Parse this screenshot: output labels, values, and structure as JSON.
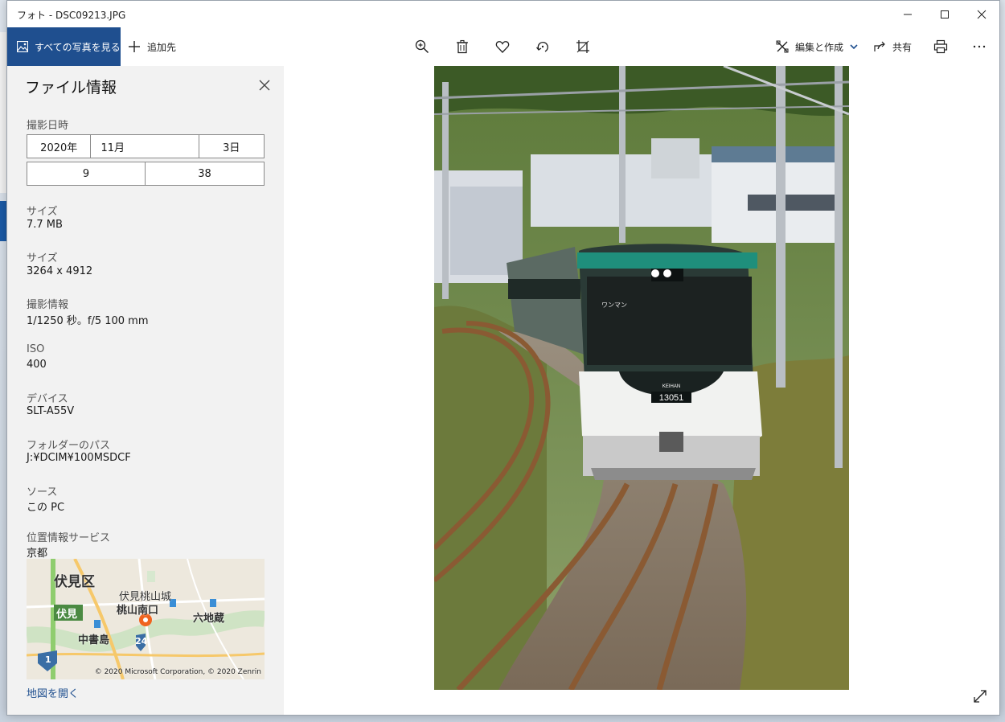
{
  "window": {
    "title": "フォト - DSC09213.JPG"
  },
  "toolbar": {
    "see_all_label": "すべての写真を見る",
    "add_to_label": "追加先",
    "edit_create_label": "編集と作成",
    "share_label": "共有"
  },
  "info": {
    "title": "ファイル情報",
    "date_taken": {
      "label": "撮影日時",
      "year": "2020年",
      "month": "11月",
      "day": "3日",
      "hour": "9",
      "minute": "38"
    },
    "file_size": {
      "label": "サイズ",
      "value": "7.7 MB"
    },
    "dimensions": {
      "label": "サイズ",
      "value": "3264 x 4912"
    },
    "camera_info": {
      "label": "撮影情報",
      "value": "1/1250 秒。f/5 100 mm"
    },
    "iso": {
      "label": "ISO",
      "value": "400"
    },
    "device": {
      "label": "デバイス",
      "value": "SLT-A55V"
    },
    "folder_path": {
      "label": "フォルダーのパス",
      "value": "J:¥DCIM¥100MSDCF"
    },
    "source": {
      "label": "ソース",
      "value": "この PC"
    },
    "location": {
      "label": "位置情報サービス",
      "value": "京都"
    },
    "map": {
      "labels": {
        "fushimi_ku": "伏見区",
        "fushimi_momoyama_castle": "伏見桃山城",
        "momoyama_minamiguchi": "桃山南口",
        "fushimi": "伏見",
        "chushojima": "中書島",
        "rokujizo": "六地蔵",
        "route_24": "24",
        "route_1": "1"
      },
      "copyright": "© 2020 Microsoft Corporation, © 2020 Zenrin"
    },
    "open_map_label": "地図を開く"
  },
  "photo": {
    "car_number": "13051",
    "car_brand": "KEIHAN",
    "destination_sign": "ワンマン"
  },
  "colors": {
    "accent": "#1f4f8f",
    "panel_bg": "#f2f2f2",
    "map_marker": "#f0641e"
  }
}
